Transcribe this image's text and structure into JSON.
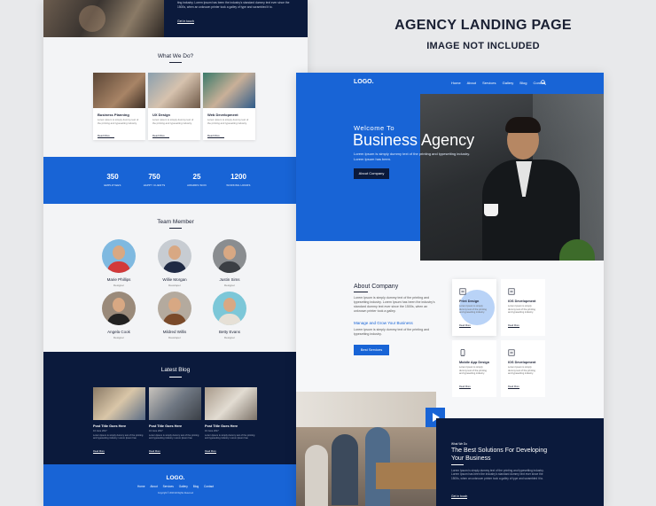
{
  "heading": {
    "title": "AGENCY LANDING PAGE",
    "subtitle": "IMAGE NOT INCLUDED"
  },
  "left": {
    "hero_text": "ting industry. Lorem Ipsum has been the industry's standard dummy text ever since the 1500s, when an unknown printer took a galley of type and scrambled it to.",
    "hero_link": "Get in touch",
    "what_we_do": {
      "title": "What We Do?",
      "cards": [
        {
          "title": "Business Planning",
          "desc": "Lorem Ipsum is simply dummy text of the printing and typesetting industry.",
          "more": "Read More"
        },
        {
          "title": "UX Design",
          "desc": "Lorem Ipsum is simply dummy text of the printing and typesetting industry.",
          "more": "Read More"
        },
        {
          "title": "Web Development",
          "desc": "Lorem Ipsum is simply dummy text of the printing and typesetting industry.",
          "more": "Read More"
        }
      ]
    },
    "stats": [
      {
        "num": "350",
        "label": "EMPLOYEES"
      },
      {
        "num": "750",
        "label": "HAPPY CLIENTS"
      },
      {
        "num": "25",
        "label": "AWARDS WON"
      },
      {
        "num": "1200",
        "label": "WORKING HOURS"
      }
    ],
    "team": {
      "title": "Team Member",
      "members": [
        {
          "name": "Marie Phillips",
          "role": "Designer"
        },
        {
          "name": "Willie Morgan",
          "role": "Developer"
        },
        {
          "name": "Justin Sims",
          "role": "Designer"
        },
        {
          "name": "Angela Cook",
          "role": "Designer"
        },
        {
          "name": "Mildred Willis",
          "role": "Developer"
        },
        {
          "name": "Betty Evans",
          "role": "Designer"
        }
      ]
    },
    "blog": {
      "title": "Latest Blog",
      "posts": [
        {
          "title": "Post Title Goes Here",
          "date": "16 June 2017",
          "desc": "Lorem Ipsum is simply dummy text of the printing and typesetting industry. Lorem Ipsum has",
          "more": "Read More"
        },
        {
          "title": "Post Title Goes Here",
          "date": "16 June 2017",
          "desc": "Lorem Ipsum is simply dummy text of the printing and typesetting industry. Lorem Ipsum has",
          "more": "Read More"
        },
        {
          "title": "Post Title Goes Here",
          "date": "16 June 2017",
          "desc": "Lorem Ipsum is simply dummy text of the printing and typesetting industry. Lorem Ipsum has",
          "more": "Read More"
        }
      ]
    },
    "footer": {
      "logo": "LOGO.",
      "nav": [
        "Home",
        "About",
        "Services",
        "Gallery",
        "Blog",
        "Contact"
      ],
      "copyright": "Copyright © 2018 All Rights Reserved"
    }
  },
  "right": {
    "logo": "LOGO.",
    "nav": [
      "Home",
      "About",
      "Services",
      "Gallery",
      "Blog",
      "Contact"
    ],
    "hero": {
      "welcome": "Welcome To",
      "title": "Business Agency",
      "desc": "Lorem Ipsum is simply dummy text of the printing and typesetting industry. Lorem Ipsum has been.",
      "button": "About Company"
    },
    "about": {
      "title": "About Company",
      "p1": "Lorem Ipsum is simply dummy text of the printing and typesetting industry. Lorem Ipsum has been the industry's standard dummy text ever since the 1500s, when an unknown printer took a galley.",
      "subtitle": "Manage and Grow Your Business",
      "p2": "Lorem Ipsum is simply dummy text of the printing and typesetting industry.",
      "button": "Best Services"
    },
    "services": [
      {
        "title": "Print Design",
        "desc": "Lorem Ipsum is simply dummy text of the printing and typesetting industry.",
        "more": "Read More"
      },
      {
        "title": "IOS Development",
        "desc": "Lorem Ipsum is simply dummy text of the printing and typesetting industry.",
        "more": "Read More"
      },
      {
        "title": "Mobile App Design",
        "desc": "Lorem Ipsum is simply dummy text of the printing and typesetting industry.",
        "more": "Read More"
      },
      {
        "title": "IOS Development",
        "desc": "Lorem Ipsum is simply dummy text of the printing and typesetting industry.",
        "more": "Read More"
      }
    ],
    "solutions": {
      "what": "What We Do",
      "title": "The Best Solutions For Developing Your Business",
      "desc": "Lorem Ipsum is simply dummy text of the printing and typesetting industry. Lorem Ipsum has been the industry's standard dummy text ever since the 1500s, when an unknown printer took a galley of type and scrambled it to.",
      "link": "Get in touch"
    }
  },
  "colors": {
    "blue": "#1864d6",
    "navy": "#0b1a3c"
  }
}
